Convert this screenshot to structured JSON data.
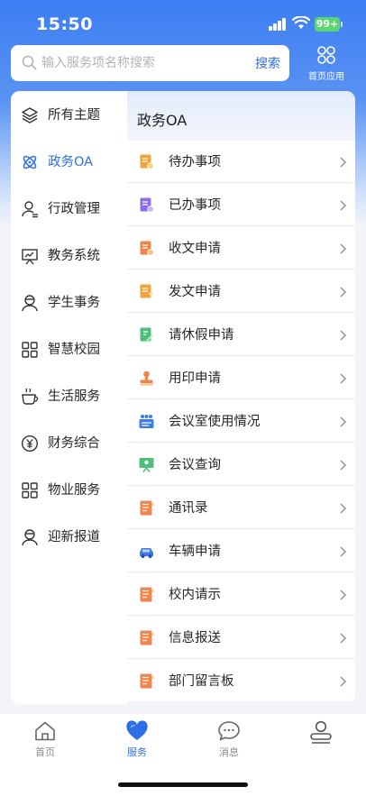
{
  "status": {
    "time": "15:50",
    "battery": "99+"
  },
  "search": {
    "placeholder": "输入服务项名称搜索",
    "button": "搜索"
  },
  "home_apps": {
    "label": "首页应用",
    "icon": "grid-icon"
  },
  "sidebar": {
    "items": [
      {
        "label": "所有主题",
        "icon": "layers-icon"
      },
      {
        "label": "政务OA",
        "icon": "atom-icon"
      },
      {
        "label": "行政管理",
        "icon": "user-badge-icon"
      },
      {
        "label": "教务系统",
        "icon": "board-icon"
      },
      {
        "label": "学生事务",
        "icon": "student-icon"
      },
      {
        "label": "智慧校园",
        "icon": "apps-icon"
      },
      {
        "label": "生活服务",
        "icon": "cup-icon"
      },
      {
        "label": "财务综合",
        "icon": "yen-icon"
      },
      {
        "label": "物业服务",
        "icon": "apps-icon"
      },
      {
        "label": "迎新报道",
        "icon": "student-icon"
      }
    ],
    "active_index": 1
  },
  "content": {
    "title": "政务OA",
    "rows": [
      {
        "label": "待办事项",
        "icon": "todo-doc-icon",
        "color": "#f4a13a"
      },
      {
        "label": "已办事项",
        "icon": "done-doc-icon",
        "color": "#8b6cf0"
      },
      {
        "label": "收文申请",
        "icon": "receive-doc-icon",
        "color": "#f2834a"
      },
      {
        "label": "发文申请",
        "icon": "send-doc-icon",
        "color": "#f4a13a"
      },
      {
        "label": "请休假申请",
        "icon": "leave-doc-icon",
        "color": "#4cc07a"
      },
      {
        "label": "用印申请",
        "icon": "stamp-icon",
        "color": "#f2834a"
      },
      {
        "label": "会议室使用情况",
        "icon": "meeting-room-icon",
        "color": "#3d7bea"
      },
      {
        "label": "会议查询",
        "icon": "presentation-icon",
        "color": "#4cc07a"
      },
      {
        "label": "通讯录",
        "icon": "contacts-icon",
        "color": "#f2834a"
      },
      {
        "label": "车辆申请",
        "icon": "car-icon",
        "color": "#3d7bea"
      },
      {
        "label": "校内请示",
        "icon": "request-doc-icon",
        "color": "#f2834a"
      },
      {
        "label": "信息报送",
        "icon": "report-doc-icon",
        "color": "#f2834a"
      },
      {
        "label": "部门留言板",
        "icon": "message-board-icon",
        "color": "#f2834a"
      }
    ]
  },
  "tabbar": {
    "items": [
      {
        "label": "首页",
        "icon": "home-icon"
      },
      {
        "label": "服务",
        "icon": "heart-icon"
      },
      {
        "label": "消息",
        "icon": "chat-icon"
      },
      {
        "label": "",
        "icon": "user-icon"
      }
    ],
    "active_index": 1
  },
  "colors": {
    "brand": "#2f6ee6",
    "header_gradient_top": "#3c7ef3",
    "text": "#262626"
  }
}
